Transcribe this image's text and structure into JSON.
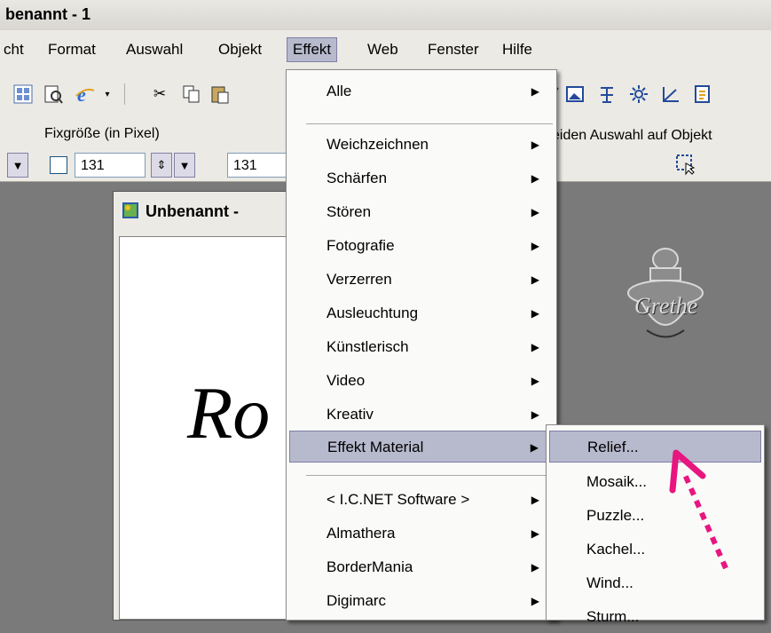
{
  "window": {
    "title": "benannt - 1"
  },
  "menubar": {
    "items": [
      {
        "label": "cht"
      },
      {
        "label": "Format"
      },
      {
        "label": "Auswahl"
      },
      {
        "label": "Objekt"
      },
      {
        "label": "Effekt"
      },
      {
        "label": "Web"
      },
      {
        "label": "Fenster"
      },
      {
        "label": "Hilfe"
      }
    ]
  },
  "propbar": {
    "fixsize_label": "Fixgröße (in Pixel)",
    "width_value": "131",
    "height_value": "131",
    "right_label": "eiden Auswahl auf Objekt"
  },
  "document": {
    "title": "Unbenannt -",
    "script_text": "Ro"
  },
  "ornament_text": "Grethe",
  "effekt_menu": {
    "items": [
      {
        "label": "Alle",
        "has_sub": true
      },
      {
        "label": "Weichzeichnen",
        "has_sub": true
      },
      {
        "label": "Schärfen",
        "has_sub": true
      },
      {
        "label": "Stören",
        "has_sub": true
      },
      {
        "label": "Fotografie",
        "has_sub": true
      },
      {
        "label": "Verzerren",
        "has_sub": true
      },
      {
        "label": "Ausleuchtung",
        "has_sub": true
      },
      {
        "label": "Künstlerisch",
        "has_sub": true
      },
      {
        "label": "Video",
        "has_sub": true
      },
      {
        "label": "Kreativ",
        "has_sub": true
      },
      {
        "label": "Effekt Material",
        "has_sub": true,
        "highlighted": true
      },
      {
        "label": "< I.C.NET Software >",
        "has_sub": true
      },
      {
        "label": "Almathera",
        "has_sub": true
      },
      {
        "label": "BorderMania",
        "has_sub": true
      },
      {
        "label": "Digimarc",
        "has_sub": true
      }
    ]
  },
  "material_submenu": {
    "items": [
      {
        "label": "Relief...",
        "highlighted": true
      },
      {
        "label": "Mosaik..."
      },
      {
        "label": "Puzzle..."
      },
      {
        "label": "Kachel..."
      },
      {
        "label": "Wind..."
      },
      {
        "label": "Sturm..."
      }
    ]
  },
  "colors": {
    "highlight": "#b7b9cd",
    "arrow_annotation": "#e8167f",
    "workspace": "#7a7a7a"
  }
}
